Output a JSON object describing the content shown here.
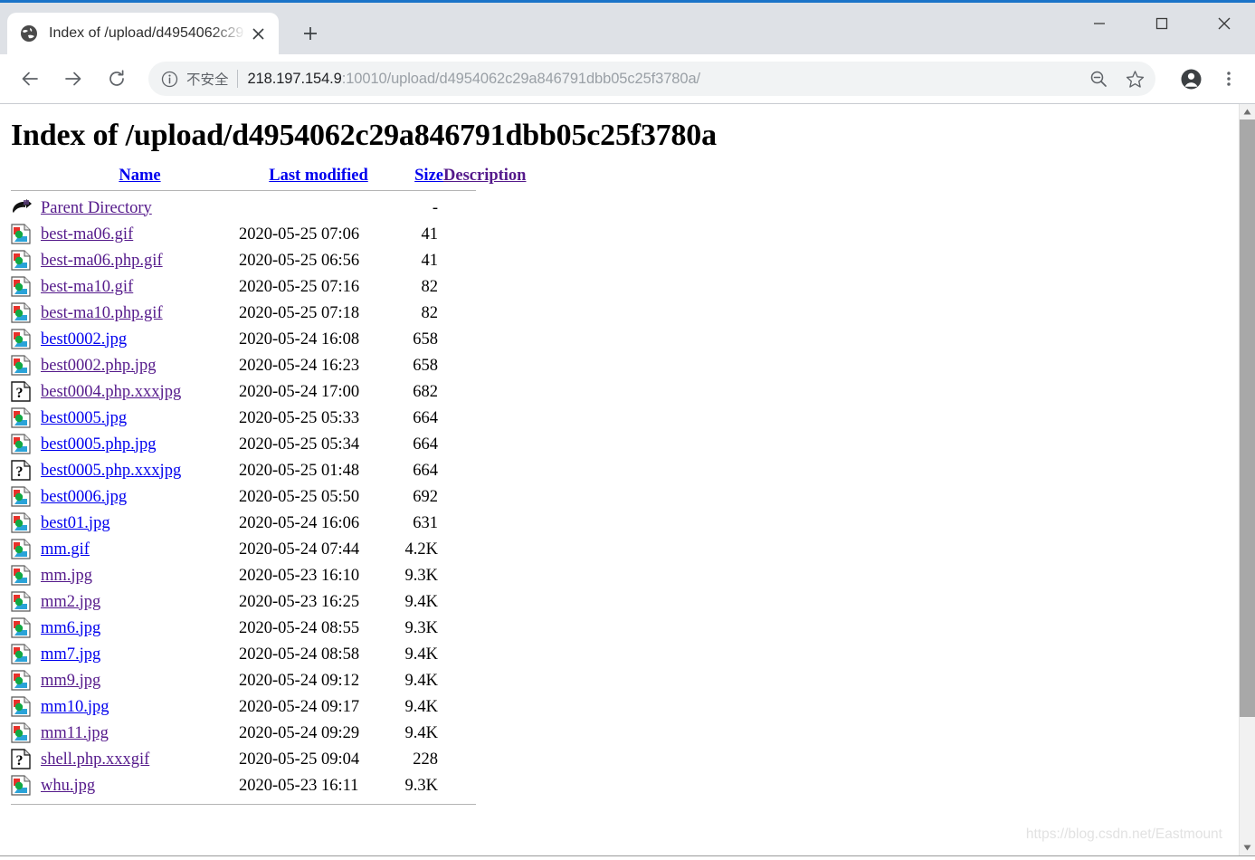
{
  "window": {
    "minimize_label": "Minimize",
    "maximize_label": "Maximize",
    "close_label": "Close"
  },
  "tab": {
    "title": "Index of /upload/d4954062c29",
    "favicon": "globe-icon",
    "close_label": "×",
    "new_tab_label": "+"
  },
  "toolbar": {
    "back_label": "←",
    "forward_label": "→",
    "reload_label": "⟳",
    "security_text": "不安全",
    "url_host": "218.197.154.9",
    "url_rest": ":10010/upload/d4954062c29a846791dbb05c25f3780a/",
    "zoom_icon": "zoom-out-icon",
    "bookmark_icon": "star-icon",
    "profile_icon": "profile-icon",
    "menu_icon": "three-dot-menu-icon"
  },
  "page": {
    "title": "Index of /upload/d4954062c29a846791dbb05c25f3780a",
    "watermark": "https://blog.csdn.net/Eastmount",
    "headers": {
      "name": "Name",
      "last_modified": "Last modified",
      "size": "Size",
      "description": "Description"
    },
    "parent": {
      "icon": "back-arrow-icon",
      "label": "Parent Directory",
      "date": "",
      "size": "-",
      "description": ""
    },
    "rows": [
      {
        "icon": "image-file-icon",
        "name": "best-ma06.gif",
        "visited": true,
        "date": "2020-05-25 07:06",
        "size": "41",
        "description": ""
      },
      {
        "icon": "image-file-icon",
        "name": "best-ma06.php.gif",
        "visited": true,
        "date": "2020-05-25 06:56",
        "size": "41",
        "description": ""
      },
      {
        "icon": "image-file-icon",
        "name": "best-ma10.gif",
        "visited": true,
        "date": "2020-05-25 07:16",
        "size": "82",
        "description": ""
      },
      {
        "icon": "image-file-icon",
        "name": "best-ma10.php.gif",
        "visited": true,
        "date": "2020-05-25 07:18",
        "size": "82",
        "description": ""
      },
      {
        "icon": "image-file-icon",
        "name": "best0002.jpg",
        "visited": false,
        "date": "2020-05-24 16:08",
        "size": "658",
        "description": ""
      },
      {
        "icon": "image-file-icon",
        "name": "best0002.php.jpg",
        "visited": true,
        "date": "2020-05-24 16:23",
        "size": "658",
        "description": ""
      },
      {
        "icon": "unknown-file-icon",
        "name": "best0004.php.xxxjpg",
        "visited": true,
        "date": "2020-05-24 17:00",
        "size": "682",
        "description": ""
      },
      {
        "icon": "image-file-icon",
        "name": "best0005.jpg",
        "visited": false,
        "date": "2020-05-25 05:33",
        "size": "664",
        "description": ""
      },
      {
        "icon": "image-file-icon",
        "name": "best0005.php.jpg",
        "visited": false,
        "date": "2020-05-25 05:34",
        "size": "664",
        "description": ""
      },
      {
        "icon": "unknown-file-icon",
        "name": "best0005.php.xxxjpg",
        "visited": false,
        "date": "2020-05-25 01:48",
        "size": "664",
        "description": ""
      },
      {
        "icon": "image-file-icon",
        "name": "best0006.jpg",
        "visited": false,
        "date": "2020-05-25 05:50",
        "size": "692",
        "description": ""
      },
      {
        "icon": "image-file-icon",
        "name": "best01.jpg",
        "visited": false,
        "date": "2020-05-24 16:06",
        "size": "631",
        "description": ""
      },
      {
        "icon": "image-file-icon",
        "name": "mm.gif",
        "visited": false,
        "date": "2020-05-24 07:44",
        "size": "4.2K",
        "description": ""
      },
      {
        "icon": "image-file-icon",
        "name": "mm.jpg",
        "visited": true,
        "date": "2020-05-23 16:10",
        "size": "9.3K",
        "description": ""
      },
      {
        "icon": "image-file-icon",
        "name": "mm2.jpg",
        "visited": true,
        "date": "2020-05-23 16:25",
        "size": "9.4K",
        "description": ""
      },
      {
        "icon": "image-file-icon",
        "name": "mm6.jpg",
        "visited": false,
        "date": "2020-05-24 08:55",
        "size": "9.3K",
        "description": ""
      },
      {
        "icon": "image-file-icon",
        "name": "mm7.jpg",
        "visited": false,
        "date": "2020-05-24 08:58",
        "size": "9.4K",
        "description": ""
      },
      {
        "icon": "image-file-icon",
        "name": "mm9.jpg",
        "visited": true,
        "date": "2020-05-24 09:12",
        "size": "9.4K",
        "description": ""
      },
      {
        "icon": "image-file-icon",
        "name": "mm10.jpg",
        "visited": false,
        "date": "2020-05-24 09:17",
        "size": "9.4K",
        "description": ""
      },
      {
        "icon": "image-file-icon",
        "name": "mm11.jpg",
        "visited": true,
        "date": "2020-05-24 09:29",
        "size": "9.4K",
        "description": ""
      },
      {
        "icon": "unknown-file-icon",
        "name": "shell.php.xxxgif",
        "visited": true,
        "date": "2020-05-25 09:04",
        "size": "228",
        "description": ""
      },
      {
        "icon": "image-file-icon",
        "name": "whu.jpg",
        "visited": true,
        "date": "2020-05-23 16:11",
        "size": "9.3K",
        "description": ""
      }
    ]
  },
  "colors": {
    "link": "#0000ee",
    "visited_link": "#551a8b",
    "accent": "#1a73c8",
    "chrome_bg": "#dee1e6"
  }
}
